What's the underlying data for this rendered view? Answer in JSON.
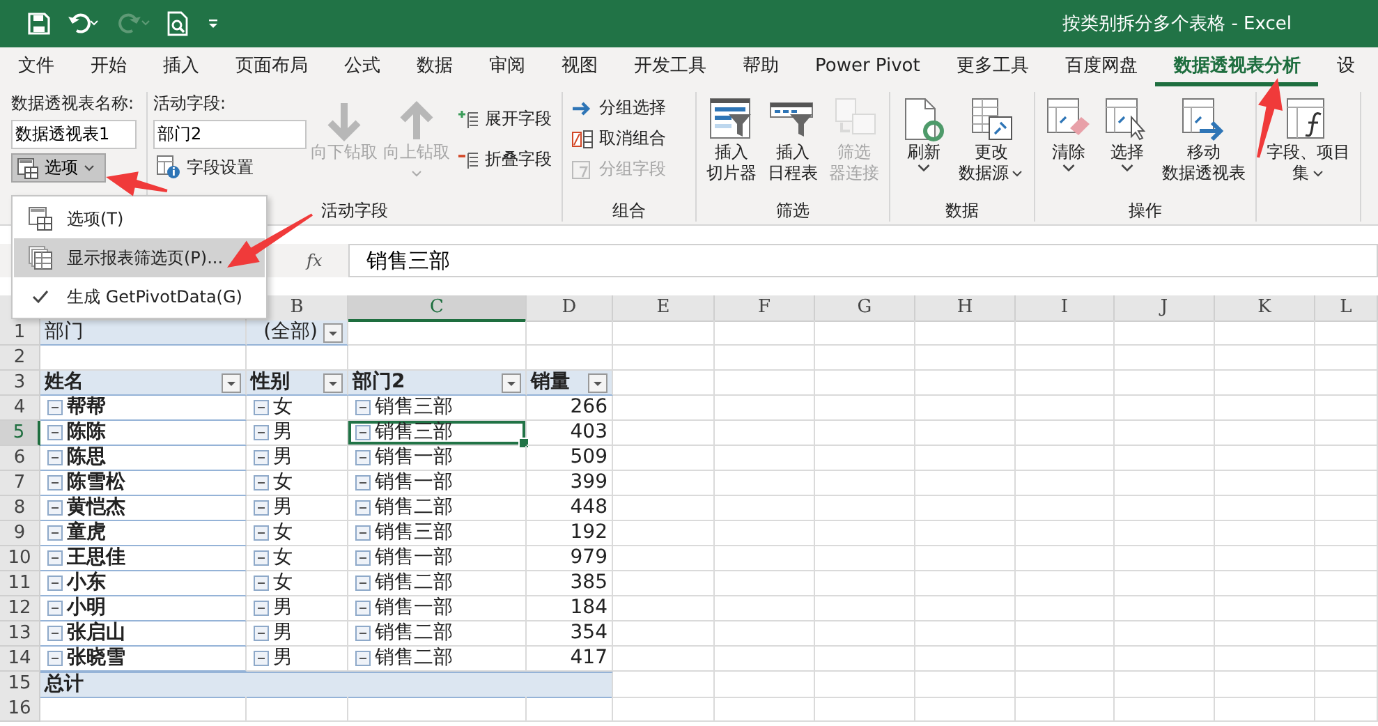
{
  "window": {
    "title": "按类别拆分多个表格 - Excel"
  },
  "tabs": [
    {
      "label": "文件",
      "selected": false
    },
    {
      "label": "开始",
      "selected": false
    },
    {
      "label": "插入",
      "selected": false
    },
    {
      "label": "页面布局",
      "selected": false
    },
    {
      "label": "公式",
      "selected": false
    },
    {
      "label": "数据",
      "selected": false
    },
    {
      "label": "审阅",
      "selected": false
    },
    {
      "label": "视图",
      "selected": false
    },
    {
      "label": "开发工具",
      "selected": false
    },
    {
      "label": "帮助",
      "selected": false
    },
    {
      "label": "Power Pivot",
      "selected": false
    },
    {
      "label": "更多工具",
      "selected": false
    },
    {
      "label": "百度网盘",
      "selected": false
    },
    {
      "label": "数据透视表分析",
      "selected": true
    },
    {
      "label": "设",
      "selected": false
    }
  ],
  "ribbon": {
    "pivot_table": {
      "name_label": "数据透视表名称:",
      "name_value": "数据透视表1",
      "options_button": {
        "label": "选项",
        "expanded": true
      }
    },
    "active_field": {
      "label": "活动字段:",
      "value": "部门2",
      "settings_button": "字段设置",
      "drill_buttons": [
        {
          "label": "向下钻取",
          "disabled": true,
          "dropdown": false,
          "kind": "down"
        },
        {
          "label": "向上钻取",
          "disabled": true,
          "dropdown": true,
          "kind": "up"
        }
      ],
      "expand_button": "展开字段",
      "collapse_button": "折叠字段",
      "group_label": "活动字段"
    },
    "group": {
      "buttons": [
        {
          "label": "分组选择",
          "disabled": false,
          "kind": "select"
        },
        {
          "label": "取消组合",
          "disabled": false,
          "kind": "ungroup"
        },
        {
          "label": "分组字段",
          "disabled": true,
          "kind": "field"
        }
      ],
      "group_label": "组合"
    },
    "large_groups": [
      {
        "label": "筛选",
        "buttons": [
          {
            "lines": [
              "插入",
              "切片器"
            ],
            "kind": "slicer",
            "disabled": false,
            "dropdown": false
          },
          {
            "lines": [
              "插入",
              "日程表"
            ],
            "kind": "timeline",
            "disabled": false,
            "dropdown": false
          },
          {
            "lines": [
              "筛选",
              "器连接"
            ],
            "kind": "connections",
            "disabled": true,
            "dropdown": false
          }
        ]
      },
      {
        "label": "数据",
        "buttons": [
          {
            "lines": [
              "刷新"
            ],
            "kind": "refresh",
            "disabled": false,
            "dropdown": true
          },
          {
            "lines": [
              "更改",
              "数据源"
            ],
            "kind": "datasource",
            "disabled": false,
            "dropdown": true
          }
        ]
      },
      {
        "label": "操作",
        "buttons": [
          {
            "lines": [
              "清除"
            ],
            "kind": "clear",
            "disabled": false,
            "dropdown": true
          },
          {
            "lines": [
              "选择"
            ],
            "kind": "select",
            "disabled": false,
            "dropdown": true
          },
          {
            "lines": [
              "移动",
              "数据透视表"
            ],
            "kind": "move",
            "disabled": false,
            "dropdown": false
          }
        ]
      },
      {
        "buttons": [
          {
            "lines": [
              "字段、项目",
              "集"
            ],
            "kind": "fields",
            "disabled": false,
            "dropdown": true
          }
        ]
      }
    ]
  },
  "options_menu": {
    "items": [
      {
        "label": "选项(T)",
        "kind": "options",
        "selected": false,
        "checked": false
      },
      {
        "label": "显示报表筛选页(P)...",
        "kind": "pages",
        "selected": true,
        "checked": false
      },
      {
        "label": "生成 GetPivotData(G)",
        "kind": "toggle",
        "selected": false,
        "checked": true
      }
    ]
  },
  "formula_bar": {
    "fx": "fx",
    "value": "销售三部"
  },
  "sheet": {
    "columns": [
      {
        "label": "B",
        "selected": false
      },
      {
        "label": "C",
        "selected": true
      },
      {
        "label": "D",
        "selected": false
      },
      {
        "label": "E",
        "selected": false
      },
      {
        "label": "F",
        "selected": false
      },
      {
        "label": "G",
        "selected": false
      },
      {
        "label": "H",
        "selected": false
      },
      {
        "label": "I",
        "selected": false
      },
      {
        "label": "J",
        "selected": false
      },
      {
        "label": "K",
        "selected": false
      },
      {
        "label": "L",
        "selected": false
      }
    ],
    "row_numbers": [
      {
        "label": "1",
        "selected": false
      },
      {
        "label": "2",
        "selected": false
      },
      {
        "label": "3",
        "selected": false
      },
      {
        "label": "4",
        "selected": false
      },
      {
        "label": "5",
        "selected": true
      },
      {
        "label": "6",
        "selected": false
      },
      {
        "label": "7",
        "selected": false
      },
      {
        "label": "8",
        "selected": false
      },
      {
        "label": "9",
        "selected": false
      },
      {
        "label": "10",
        "selected": false
      },
      {
        "label": "11",
        "selected": false
      },
      {
        "label": "12",
        "selected": false
      },
      {
        "label": "13",
        "selected": false
      },
      {
        "label": "14",
        "selected": false
      },
      {
        "label": "15",
        "selected": false
      },
      {
        "label": "16",
        "selected": false
      }
    ],
    "report_filter": {
      "field": "部门",
      "value": "(全部)"
    },
    "pivot": {
      "headers": [
        "姓名",
        "性别",
        "部门2",
        "销量"
      ],
      "rows": [
        {
          "name": "帮帮",
          "gender": "女",
          "dept": "销售三部",
          "sales": "266",
          "selected": false
        },
        {
          "name": "陈陈",
          "gender": "男",
          "dept": "销售三部",
          "sales": "403",
          "selected": true
        },
        {
          "name": "陈思",
          "gender": "男",
          "dept": "销售一部",
          "sales": "509",
          "selected": false
        },
        {
          "name": "陈雪松",
          "gender": "女",
          "dept": "销售一部",
          "sales": "399",
          "selected": false
        },
        {
          "name": "黄恺杰",
          "gender": "男",
          "dept": "销售二部",
          "sales": "448",
          "selected": false
        },
        {
          "name": "童虎",
          "gender": "女",
          "dept": "销售三部",
          "sales": "192",
          "selected": false
        },
        {
          "name": "王思佳",
          "gender": "女",
          "dept": "销售一部",
          "sales": "979",
          "selected": false
        },
        {
          "name": "小东",
          "gender": "女",
          "dept": "销售二部",
          "sales": "385",
          "selected": false
        },
        {
          "name": "小明",
          "gender": "男",
          "dept": "销售一部",
          "sales": "184",
          "selected": false
        },
        {
          "name": "张启山",
          "gender": "男",
          "dept": "销售二部",
          "sales": "354",
          "selected": false
        },
        {
          "name": "张晓雪",
          "gender": "男",
          "dept": "销售二部",
          "sales": "417",
          "selected": false
        }
      ],
      "total_label": "总计"
    }
  }
}
